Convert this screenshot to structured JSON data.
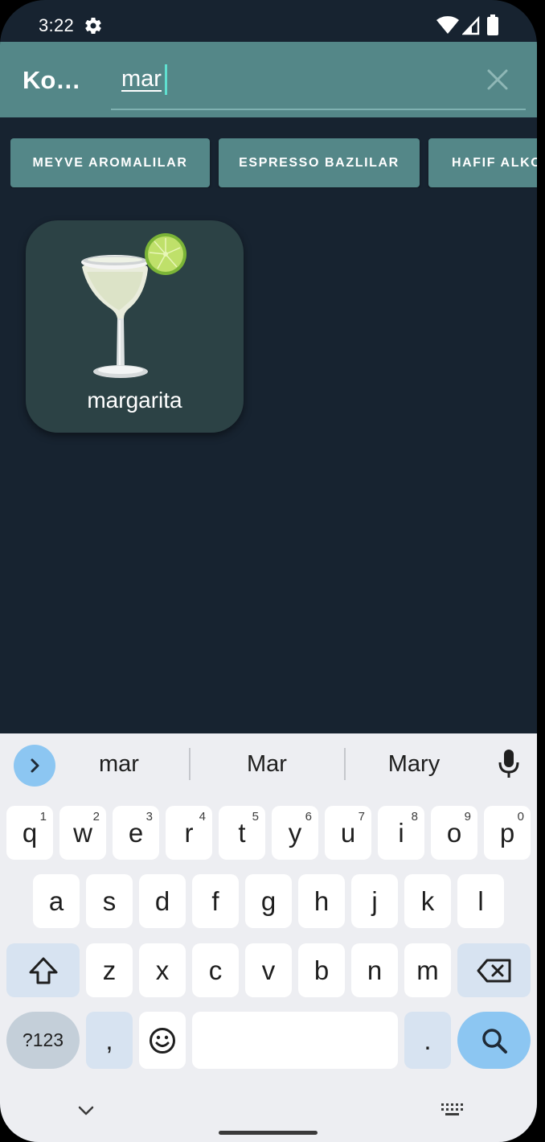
{
  "status": {
    "time": "3:22"
  },
  "appbar": {
    "title": "Ko…"
  },
  "search": {
    "value": "mar"
  },
  "chips": [
    {
      "label": "MEYVE AROMALILAR"
    },
    {
      "label": "ESPRESSO BAZLILAR"
    },
    {
      "label": "HAFIF ALKOL"
    }
  ],
  "results": [
    {
      "name": "margarita"
    }
  ],
  "keyboard": {
    "suggestions": [
      "mar",
      "Mar",
      "Mary"
    ],
    "row1": [
      {
        "k": "q",
        "h": "1"
      },
      {
        "k": "w",
        "h": "2"
      },
      {
        "k": "e",
        "h": "3"
      },
      {
        "k": "r",
        "h": "4"
      },
      {
        "k": "t",
        "h": "5"
      },
      {
        "k": "y",
        "h": "6"
      },
      {
        "k": "u",
        "h": "7"
      },
      {
        "k": "i",
        "h": "8"
      },
      {
        "k": "o",
        "h": "9"
      },
      {
        "k": "p",
        "h": "0"
      }
    ],
    "row2": [
      "a",
      "s",
      "d",
      "f",
      "g",
      "h",
      "j",
      "k",
      "l"
    ],
    "row3": [
      "z",
      "x",
      "c",
      "v",
      "b",
      "n",
      "m"
    ],
    "symbols_label": "?123",
    "comma": ",",
    "period": "."
  },
  "colors": {
    "accent": "#548788",
    "background": "#172330",
    "card": "#2c4245"
  }
}
